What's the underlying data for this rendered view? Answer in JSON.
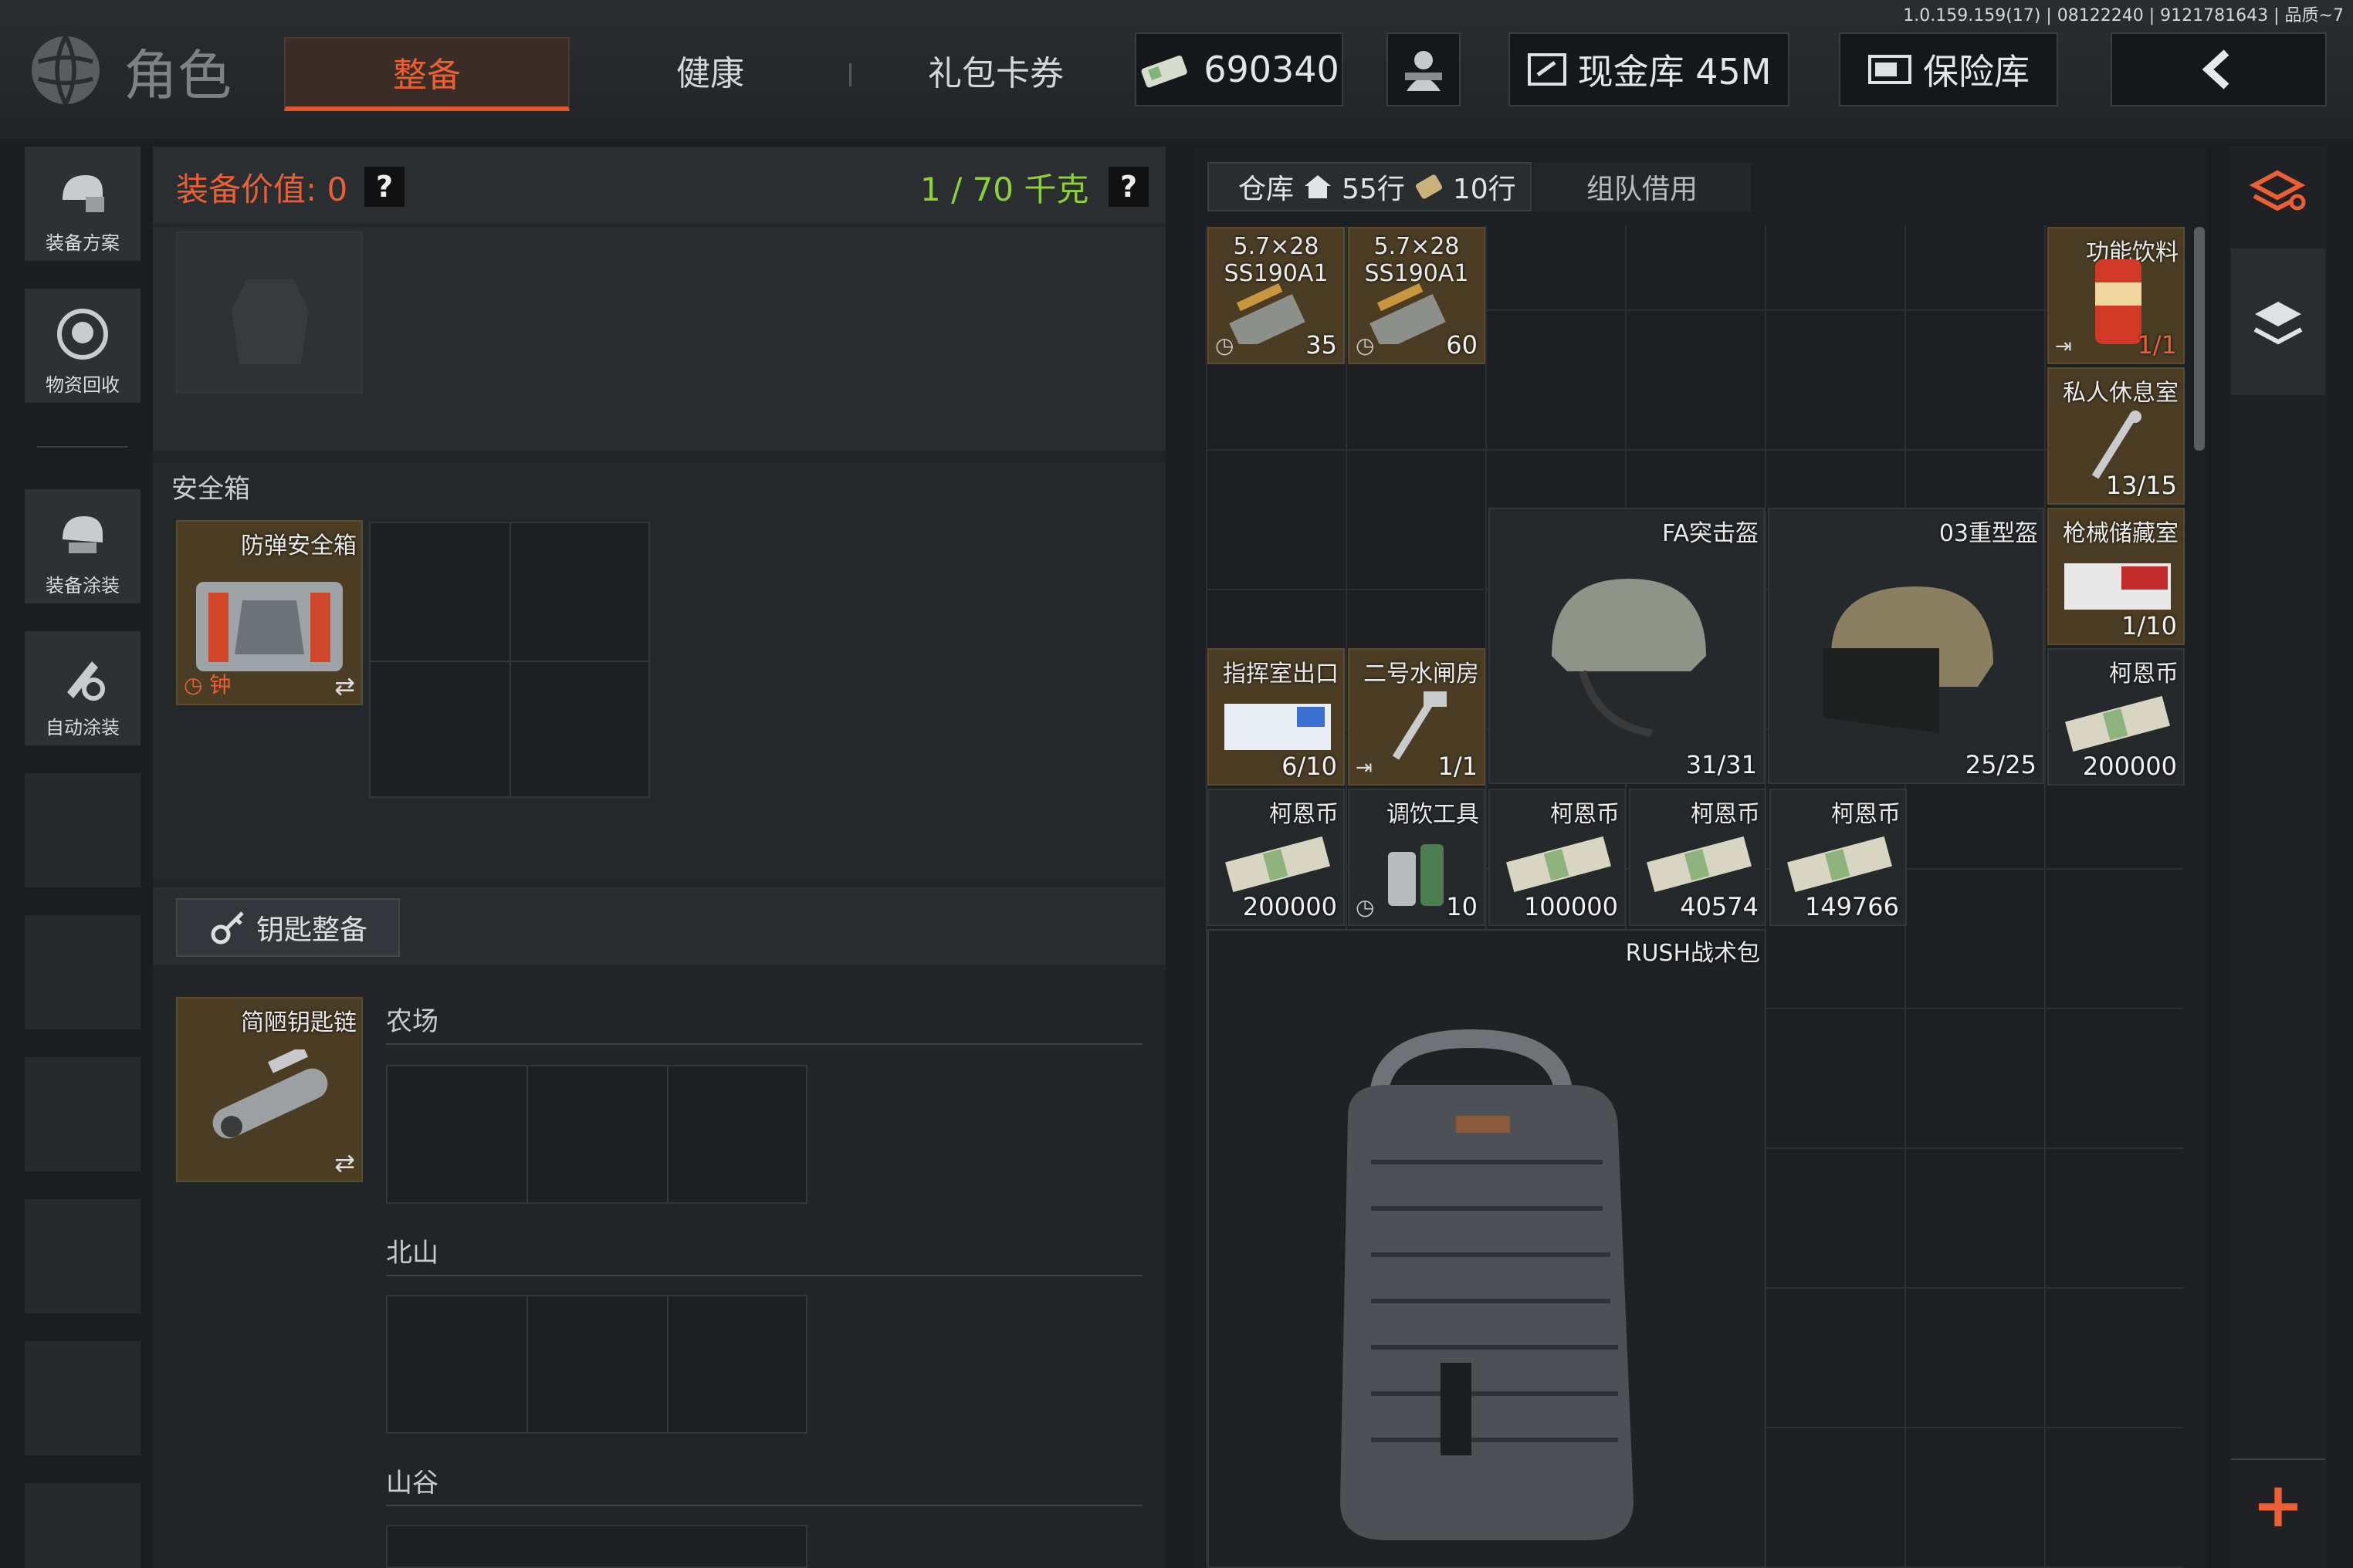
{
  "version": "1.0.159.159(17) | 08122240 | 9121781643 | 品质~7",
  "header": {
    "title": "角色",
    "tabs": [
      {
        "label": "整备",
        "active": true
      },
      {
        "label": "健康",
        "active": false
      },
      {
        "label": "礼包卡券",
        "active": false
      }
    ],
    "currency": "690340",
    "cash_vault": "现金库 45M",
    "safe_vault": "保险库"
  },
  "sidebar": {
    "items": [
      {
        "label": "装备方案",
        "icon": "loadout-icon"
      },
      {
        "label": "物资回收",
        "icon": "recycle-icon"
      },
      {
        "label": "装备涂装",
        "icon": "paint-icon"
      },
      {
        "label": "自动涂装",
        "icon": "auto-paint-icon"
      }
    ]
  },
  "equipment": {
    "value_label": "装备价值: 0",
    "weight_label": "1 / 70 千克",
    "help": "?",
    "safe_box_title": "安全箱",
    "safe_box_item": {
      "name": "防弹安全箱",
      "timer": "钟"
    },
    "key_section_title": "钥匙整备",
    "keychain_item": {
      "name": "简陋钥匙链"
    },
    "key_areas": [
      "农场",
      "北山",
      "山谷"
    ]
  },
  "warehouse": {
    "tab_label": "仓库",
    "rows_home": "55行",
    "rows_ticket": "10行",
    "team_borrow": "组队借用",
    "items": [
      {
        "name": "5.7×28 SS190A1",
        "count": "35"
      },
      {
        "name": "5.7×28 SS190A1",
        "count": "60"
      },
      {
        "name": "功能饮料",
        "count": "1/1"
      },
      {
        "name": "私人休息室",
        "count": "13/15"
      },
      {
        "name": "FA突击盔",
        "count": "31/31"
      },
      {
        "name": "03重型盔",
        "count": "25/25"
      },
      {
        "name": "枪械储藏室",
        "count": "1/10"
      },
      {
        "name": "指挥室出口",
        "count": "6/10"
      },
      {
        "name": "二号水闸房",
        "count": "1/1"
      },
      {
        "name": "柯恩币",
        "count": "200000"
      },
      {
        "name": "柯恩币",
        "count": "200000"
      },
      {
        "name": "调饮工具",
        "count": "10"
      },
      {
        "name": "柯恩币",
        "count": "100000"
      },
      {
        "name": "柯恩币",
        "count": "40574"
      },
      {
        "name": "柯恩币",
        "count": "149766"
      },
      {
        "name": "RUSH战术包",
        "count": ""
      }
    ]
  },
  "colors": {
    "accent": "#ec5f34",
    "green": "#8dd13a",
    "item_bg": "#4a3d24"
  }
}
